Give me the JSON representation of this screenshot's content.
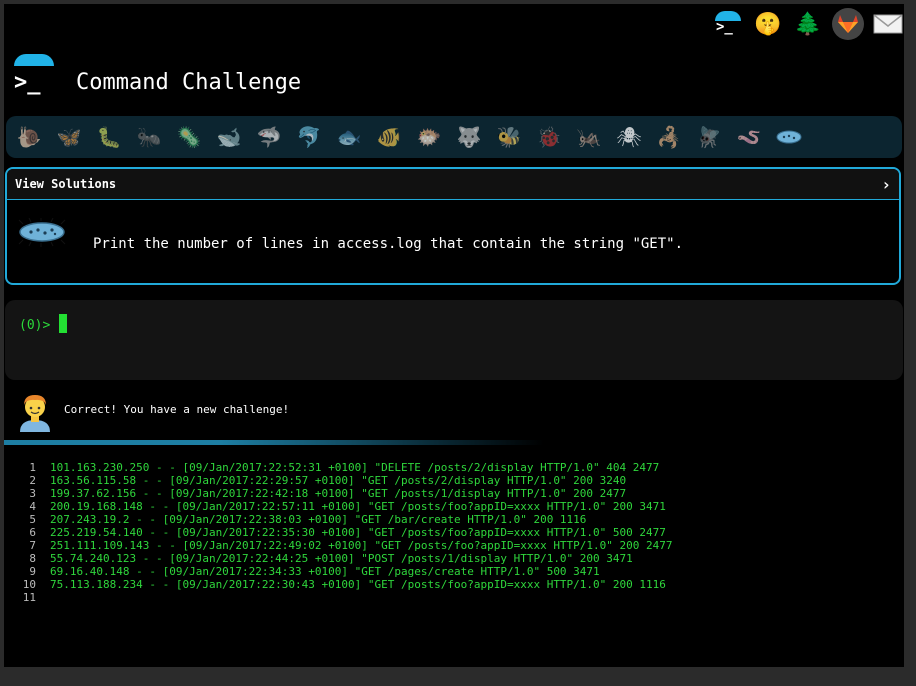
{
  "header": {
    "title": "Command Challenge",
    "logo_text": ">_",
    "top_icons": [
      "terminal-icon",
      "shushing-face-icon",
      "tree-icon",
      "gitlab-icon",
      "mail-icon"
    ]
  },
  "critters": {
    "items": [
      {
        "name": "snail",
        "glyph": "🐌"
      },
      {
        "name": "butterfly",
        "glyph": "🦋"
      },
      {
        "name": "caterpillar",
        "glyph": "🐛"
      },
      {
        "name": "ant",
        "glyph": "🐜"
      },
      {
        "name": "microbe",
        "glyph": "🦠"
      },
      {
        "name": "whale",
        "glyph": "🐋"
      },
      {
        "name": "shark",
        "glyph": "🦈"
      },
      {
        "name": "dolphin",
        "glyph": "🐬"
      },
      {
        "name": "fish",
        "glyph": "🐟"
      },
      {
        "name": "tropical-fish",
        "glyph": "🐠"
      },
      {
        "name": "blowfish",
        "glyph": "🐡"
      },
      {
        "name": "wolf",
        "glyph": "🐺"
      },
      {
        "name": "bee",
        "glyph": "🐝"
      },
      {
        "name": "ladybug",
        "glyph": "🐞"
      },
      {
        "name": "cricket",
        "glyph": "🦗"
      },
      {
        "name": "spider",
        "glyph": "🕷"
      },
      {
        "name": "scorpion",
        "glyph": "🦂"
      },
      {
        "name": "fly",
        "glyph": "🪰"
      },
      {
        "name": "worm",
        "glyph": "🪱"
      },
      {
        "name": "paramecium",
        "glyph": ""
      }
    ]
  },
  "challenge": {
    "header_label": "View Solutions",
    "chevron": "›",
    "task": "Print the number of lines in access.log that contain the string \"GET\"."
  },
  "terminal": {
    "prompt": "(0)>"
  },
  "result": {
    "message": "Correct! You have a new challenge!"
  },
  "listing": {
    "lines": [
      {
        "n": "1",
        "text": "101.163.230.250 - - [09/Jan/2017:22:52:31 +0100] \"DELETE /posts/2/display HTTP/1.0\" 404 2477"
      },
      {
        "n": "2",
        "text": "163.56.115.58 - - [09/Jan/2017:22:29:57 +0100] \"GET /posts/2/display HTTP/1.0\" 200 3240"
      },
      {
        "n": "3",
        "text": "199.37.62.156 - - [09/Jan/2017:22:42:18 +0100] \"GET /posts/1/display HTTP/1.0\" 200 2477"
      },
      {
        "n": "4",
        "text": "200.19.168.148 - - [09/Jan/2017:22:57:11 +0100] \"GET /posts/foo?appID=xxxx HTTP/1.0\" 200 3471"
      },
      {
        "n": "5",
        "text": "207.243.19.2 - - [09/Jan/2017:22:38:03 +0100] \"GET /bar/create HTTP/1.0\" 200 1116"
      },
      {
        "n": "6",
        "text": "225.219.54.140 - - [09/Jan/2017:22:35:30 +0100] \"GET /posts/foo?appID=xxxx HTTP/1.0\" 500 2477"
      },
      {
        "n": "7",
        "text": "251.111.109.143 - - [09/Jan/2017:22:49:02 +0100] \"GET /posts/foo?appID=xxxx HTTP/1.0\" 200 2477"
      },
      {
        "n": "8",
        "text": "55.74.240.123 - - [09/Jan/2017:22:44:25 +0100] \"POST /posts/1/display HTTP/1.0\" 200 3471"
      },
      {
        "n": "9",
        "text": "69.16.40.148 - - [09/Jan/2017:22:34:33 +0100] \"GET /pages/create HTTP/1.0\" 500 3471"
      },
      {
        "n": "10",
        "text": "75.113.188.234 - - [09/Jan/2017:22:30:43 +0100] \"GET /posts/foo?appID=xxxx HTTP/1.0\" 200 1116"
      },
      {
        "n": "11",
        "text": ""
      }
    ]
  },
  "colors": {
    "accent": "#21a9d9",
    "prompt_green": "#2bd93a",
    "background": "#000000"
  }
}
